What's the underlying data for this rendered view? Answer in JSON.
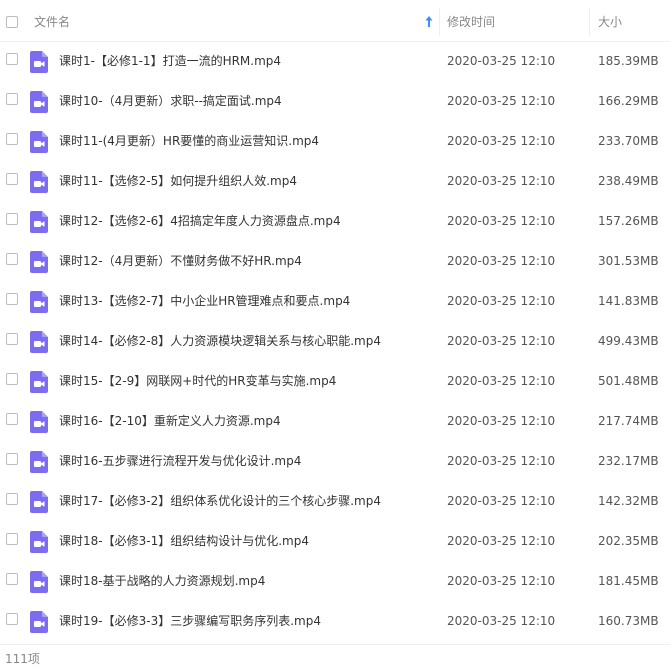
{
  "header": {
    "name_label": "文件名",
    "modified_label": "修改时间",
    "size_label": "大小",
    "sort_icon": "arrow-up-icon",
    "sort_color": "#3b8cff"
  },
  "file_icon": {
    "name": "video-file-icon",
    "color": "#7c6cf0"
  },
  "files": [
    {
      "name": "课时1-【必修1-1】打造一流的HRM.mp4",
      "modified": "2020-03-25 12:10",
      "size": "185.39MB"
    },
    {
      "name": "课时10-（4月更新）求职--搞定面试.mp4",
      "modified": "2020-03-25 12:10",
      "size": "166.29MB"
    },
    {
      "name": "课时11-(4月更新）HR要懂的商业运营知识.mp4",
      "modified": "2020-03-25 12:10",
      "size": "233.70MB"
    },
    {
      "name": "课时11-【选修2-5】如何提升组织人效.mp4",
      "modified": "2020-03-25 12:10",
      "size": "238.49MB"
    },
    {
      "name": "课时12-【选修2-6】4招搞定年度人力资源盘点.mp4",
      "modified": "2020-03-25 12:10",
      "size": "157.26MB"
    },
    {
      "name": "课时12-（4月更新）不懂财务做不好HR.mp4",
      "modified": "2020-03-25 12:10",
      "size": "301.53MB"
    },
    {
      "name": "课时13-【选修2-7】中小企业HR管理难点和要点.mp4",
      "modified": "2020-03-25 12:10",
      "size": "141.83MB"
    },
    {
      "name": "课时14-【必修2-8】人力资源模块逻辑关系与核心职能.mp4",
      "modified": "2020-03-25 12:10",
      "size": "499.43MB"
    },
    {
      "name": "课时15-【2-9】网联网+时代的HR变革与实施.mp4",
      "modified": "2020-03-25 12:10",
      "size": "501.48MB"
    },
    {
      "name": "课时16-【2-10】重新定义人力资源.mp4",
      "modified": "2020-03-25 12:10",
      "size": "217.74MB"
    },
    {
      "name": "课时16-五步骤进行流程开发与优化设计.mp4",
      "modified": "2020-03-25 12:10",
      "size": "232.17MB"
    },
    {
      "name": "课时17-【必修3-2】组织体系优化设计的三个核心步骤.mp4",
      "modified": "2020-03-25 12:10",
      "size": "142.32MB"
    },
    {
      "name": "课时18-【必修3-1】组织结构设计与优化.mp4",
      "modified": "2020-03-25 12:10",
      "size": "202.35MB"
    },
    {
      "name": "课时18-基于战略的人力资源规划.mp4",
      "modified": "2020-03-25 12:10",
      "size": "181.45MB"
    },
    {
      "name": "课时19-【必修3-3】三步骤编写职务序列表.mp4",
      "modified": "2020-03-25 12:10",
      "size": "160.73MB"
    }
  ],
  "footer": {
    "count_label": "111项"
  }
}
